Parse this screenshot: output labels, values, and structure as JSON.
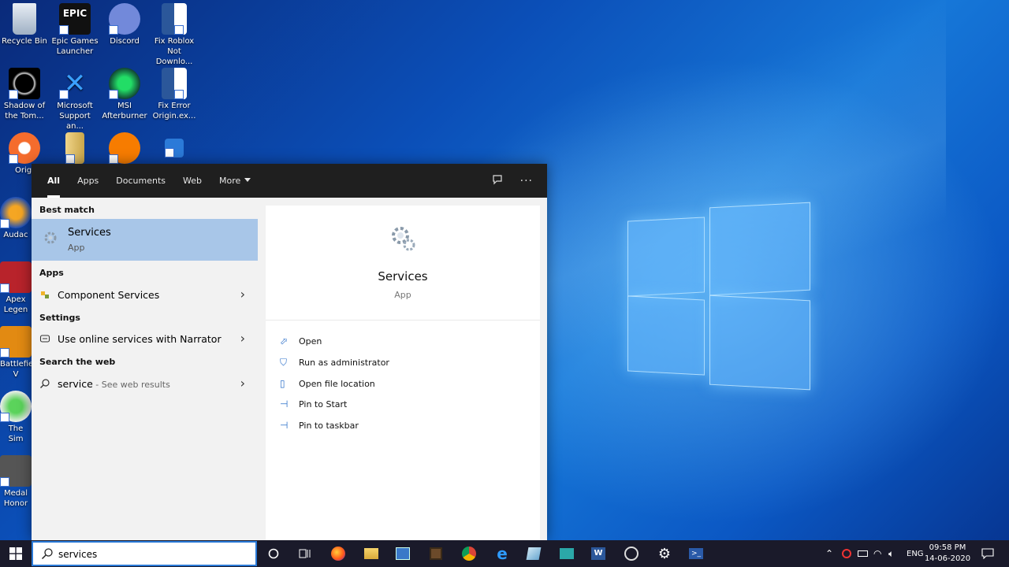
{
  "desktop": {
    "icons": [
      {
        "label": "Recycle Bin"
      },
      {
        "label": "Epic Games Launcher"
      },
      {
        "label": "Discord"
      },
      {
        "label": "Fix Roblox Not Downlo..."
      },
      {
        "label": "Shadow of the Tom..."
      },
      {
        "label": "Microsoft Support an..."
      },
      {
        "label": "MSI Afterburner"
      },
      {
        "label": "Fix Error Origin.ex..."
      },
      {
        "label": "Origi"
      },
      {
        "label": "Audac"
      },
      {
        "label": "Apex Legen"
      },
      {
        "label": "Battlefie V"
      },
      {
        "label": "The Sim"
      },
      {
        "label": "Medal Honor"
      }
    ]
  },
  "search_panel": {
    "tabs": [
      {
        "label": "All"
      },
      {
        "label": "Apps"
      },
      {
        "label": "Documents"
      },
      {
        "label": "Web"
      },
      {
        "label": "More"
      }
    ],
    "sections": {
      "best_match": "Best match",
      "apps": "Apps",
      "settings": "Settings",
      "search_web": "Search the web"
    },
    "best_match": {
      "title": "Services",
      "subtitle": "App"
    },
    "apps_items": [
      {
        "label": "Component Services"
      }
    ],
    "settings_items": [
      {
        "label": "Use online services with Narrator"
      }
    ],
    "web_items": [
      {
        "label": "service",
        "sub": " - See web results"
      }
    ],
    "preview": {
      "title": "Services",
      "subtitle": "App"
    },
    "actions": [
      {
        "label": "Open",
        "icon": "open-icon"
      },
      {
        "label": "Run as administrator",
        "icon": "shield-icon"
      },
      {
        "label": "Open file location",
        "icon": "file-icon"
      },
      {
        "label": "Pin to Start",
        "icon": "pin-icon"
      },
      {
        "label": "Pin to taskbar",
        "icon": "pin-icon"
      }
    ]
  },
  "taskbar": {
    "search_query": "services",
    "language": "ENG",
    "time": "09:58 PM",
    "date": "14-06-2020"
  }
}
